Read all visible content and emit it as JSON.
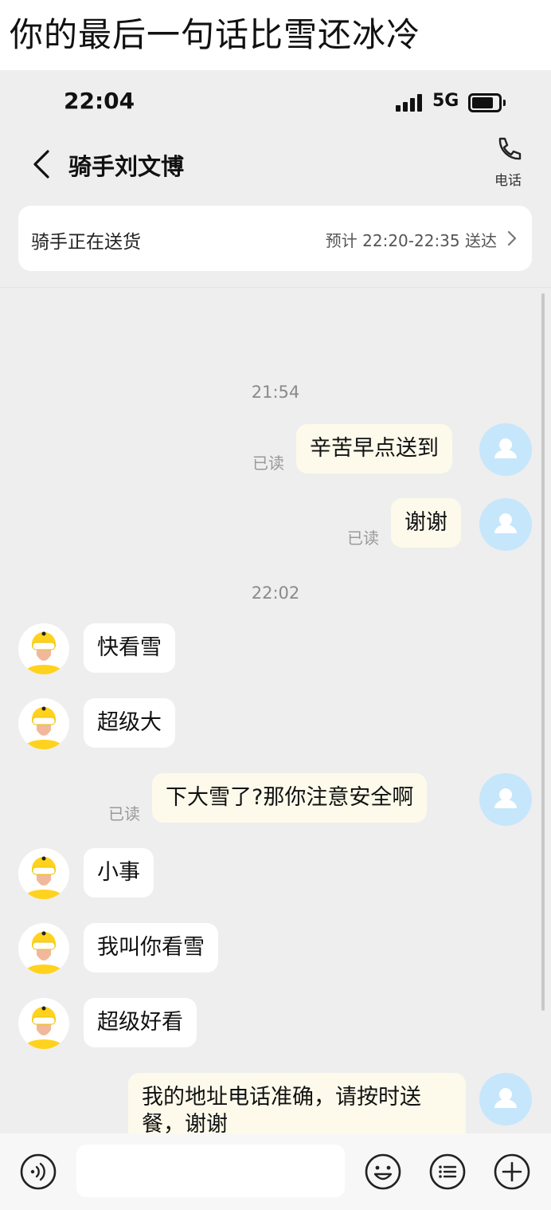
{
  "caption": "你的最后一句话比雪还冰冷",
  "status_bar": {
    "time": "22:04",
    "network": "5G"
  },
  "nav": {
    "title": "骑手刘文博",
    "call_label": "电话"
  },
  "delivery": {
    "status": "骑手正在送货",
    "eta": "预计 22:20-22:35 送达"
  },
  "messages": {
    "ts1": "21:54",
    "m1": "辛苦早点送到",
    "m1_read": "已读",
    "m2": "谢谢",
    "m2_read": "已读",
    "ts2": "22:02",
    "m3": "快看雪",
    "m4": "超级大",
    "m5": "下大雪了?那你注意安全啊",
    "m5_read": "已读",
    "m6": "小事",
    "m7": "我叫你看雪",
    "m8": "超级好看",
    "m9_line1": "我的地址电话准确，请按时送",
    "m9_line2": "餐，谢谢"
  },
  "input": {
    "value": ""
  },
  "colors": {
    "chat_bg": "#eeeeee",
    "outgoing_bubble": "#fdfaeb",
    "incoming_bubble": "#ffffff",
    "user_avatar": "#c6e6fb",
    "rider_helmet": "#ffd21e"
  },
  "icons": [
    "back-icon",
    "phone-icon",
    "chevron-right-icon",
    "user-avatar-icon",
    "rider-avatar-icon",
    "voice-icon",
    "emoji-icon",
    "quick-reply-icon",
    "plus-icon"
  ]
}
